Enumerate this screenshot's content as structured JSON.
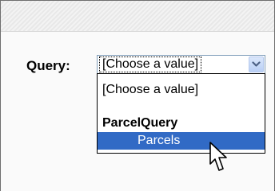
{
  "query": {
    "label": "Query:",
    "select": {
      "selected_value": "[Choose a value]",
      "dropdown_icon": "chevron-down-icon"
    },
    "options": [
      {
        "label": "[Choose a value]",
        "type": "option"
      },
      {
        "label": "ParcelQuery",
        "type": "group-header"
      },
      {
        "label": "Parcels",
        "type": "option",
        "highlighted": true
      }
    ]
  },
  "cursor": {
    "icon": "hand-pointer-icon"
  },
  "colors": {
    "highlight": "#316ac5",
    "highlight_text": "#ffffff",
    "select_border": "#7f9db9",
    "dropdown_button": "#c3d4f7"
  }
}
